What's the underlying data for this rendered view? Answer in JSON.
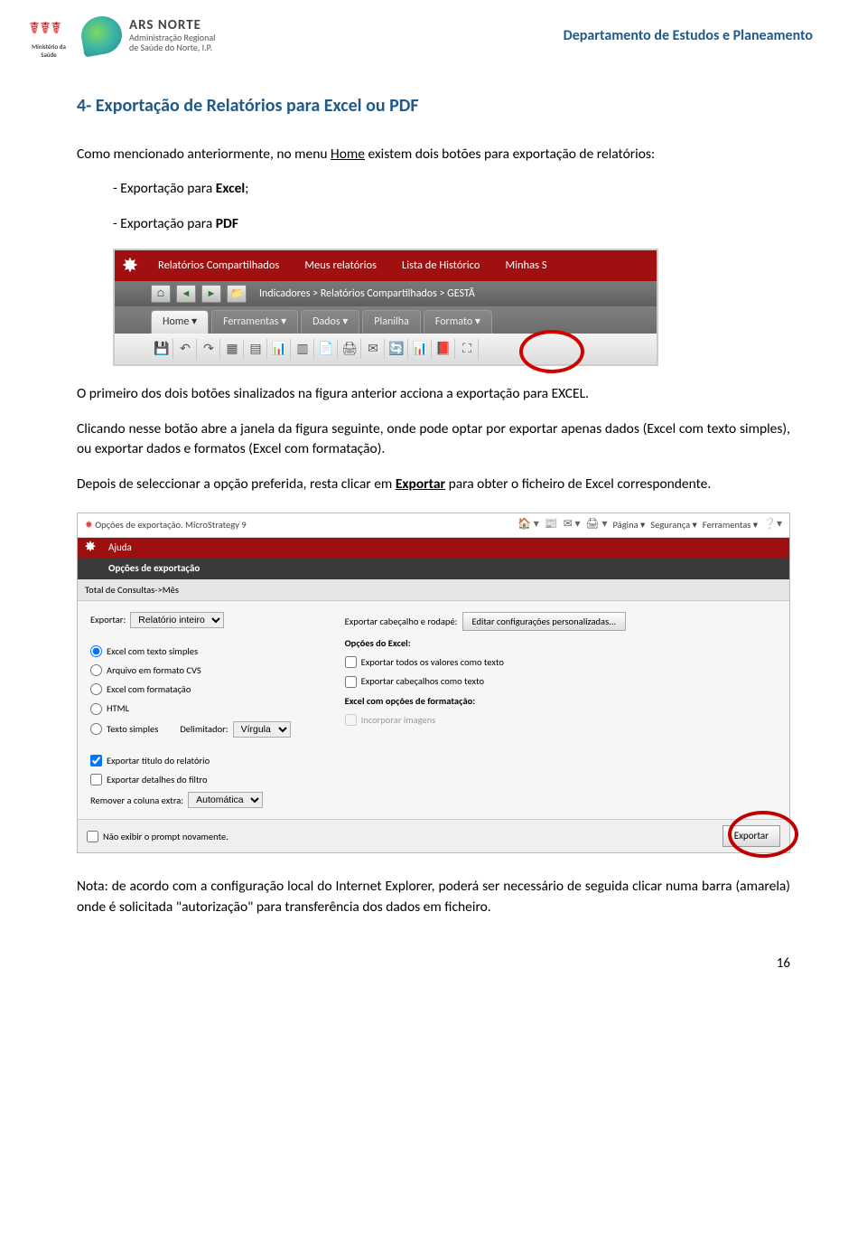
{
  "header": {
    "ministerio_caption": "Ministério da Saúde",
    "ars_main": "ARS NORTE",
    "ars_sub1": "Administração Regional",
    "ars_sub2": "de Saúde do Norte, I.P.",
    "department": "Departamento de Estudos e Planeamento"
  },
  "doc": {
    "section_title": "4- Exportação de Relatórios para Excel ou PDF",
    "p1a": "Como mencionado anteriormente, no menu ",
    "p1_home": "Home",
    "p1b": " existem dois botões para exportação de relatórios:",
    "li1a": "- Exportação para ",
    "li1b": "Excel",
    "li1c": ";",
    "li2a": "- Exportação para ",
    "li2b": "PDF",
    "p2": "O primeiro dos dois botões sinalizados na figura anterior acciona a exportação para EXCEL.",
    "p3": "Clicando nesse botão abre a janela da figura seguinte, onde pode optar por exportar apenas dados (Excel com texto simples), ou exportar dados e formatos (Excel com formatação).",
    "p4a": "Depois de seleccionar a opção preferida, resta clicar em ",
    "p4_exp": "Exportar",
    "p4b": " para obter o ficheiro de Excel correspondente.",
    "note": "Nota: de acordo com a configuração local do Internet Explorer, poderá ser necessário de seguida clicar numa barra (amarela) onde é solicitada \"autorização\" para transferência dos dados em ficheiro.",
    "page_number": "16"
  },
  "shot1": {
    "menu": {
      "rel_comp": "Relatórios Compartilhados",
      "meus": "Meus relatórios",
      "historico": "Lista de Histórico",
      "minhas": "Minhas S"
    },
    "breadcrumb": "Indicadores > Relatórios Compartilhados > GESTÃ",
    "tabs": {
      "home": "Home  ▾",
      "ferramentas": "Ferramentas  ▾",
      "dados": "Dados  ▾",
      "planilha": "Planilha",
      "formato": "Formato  ▾"
    }
  },
  "shot2": {
    "browser_title": "Opções de exportação. MicroStrategy 9",
    "browser_right": {
      "pagina": "Página ▾",
      "seguranca": "Segurança ▾",
      "ferramentas": "Ferramentas ▾"
    },
    "ajuda": "Ajuda",
    "title_bar": "Opções de exportação",
    "subheader": "Total de Consultas->Mês",
    "left": {
      "exportar_label": "Exportar:",
      "exportar_select": "Relatório inteiro",
      "opt_excel_simple": "Excel com texto simples",
      "opt_csv": "Arquivo em formato CVS",
      "opt_excel_fmt": "Excel com formatação",
      "opt_html": "HTML",
      "opt_texto": "Texto simples",
      "delim_label": "Delimitador:",
      "delim_value": "Vírgula",
      "chk_titulo": "Exportar título do relatório",
      "chk_detalhes": "Exportar detalhes do filtro",
      "remover_label": "Remover a coluna extra:",
      "remover_value": "Automática"
    },
    "right": {
      "cab_label": "Exportar cabeçalho e rodapé:",
      "cab_btn": "Editar configurações personalizadas...",
      "opcoes_excel": "Opções do Excel:",
      "chk_valores_texto": "Exportar todos os valores como texto",
      "chk_cab_texto": "Exportar cabeçalhos como texto",
      "excel_fmt_label": "Excel com opções de formatação:",
      "chk_incorp": "Incorporar imagens"
    },
    "bottom_chk": "Não exibir o prompt novamente.",
    "export_btn": "Exportar"
  }
}
